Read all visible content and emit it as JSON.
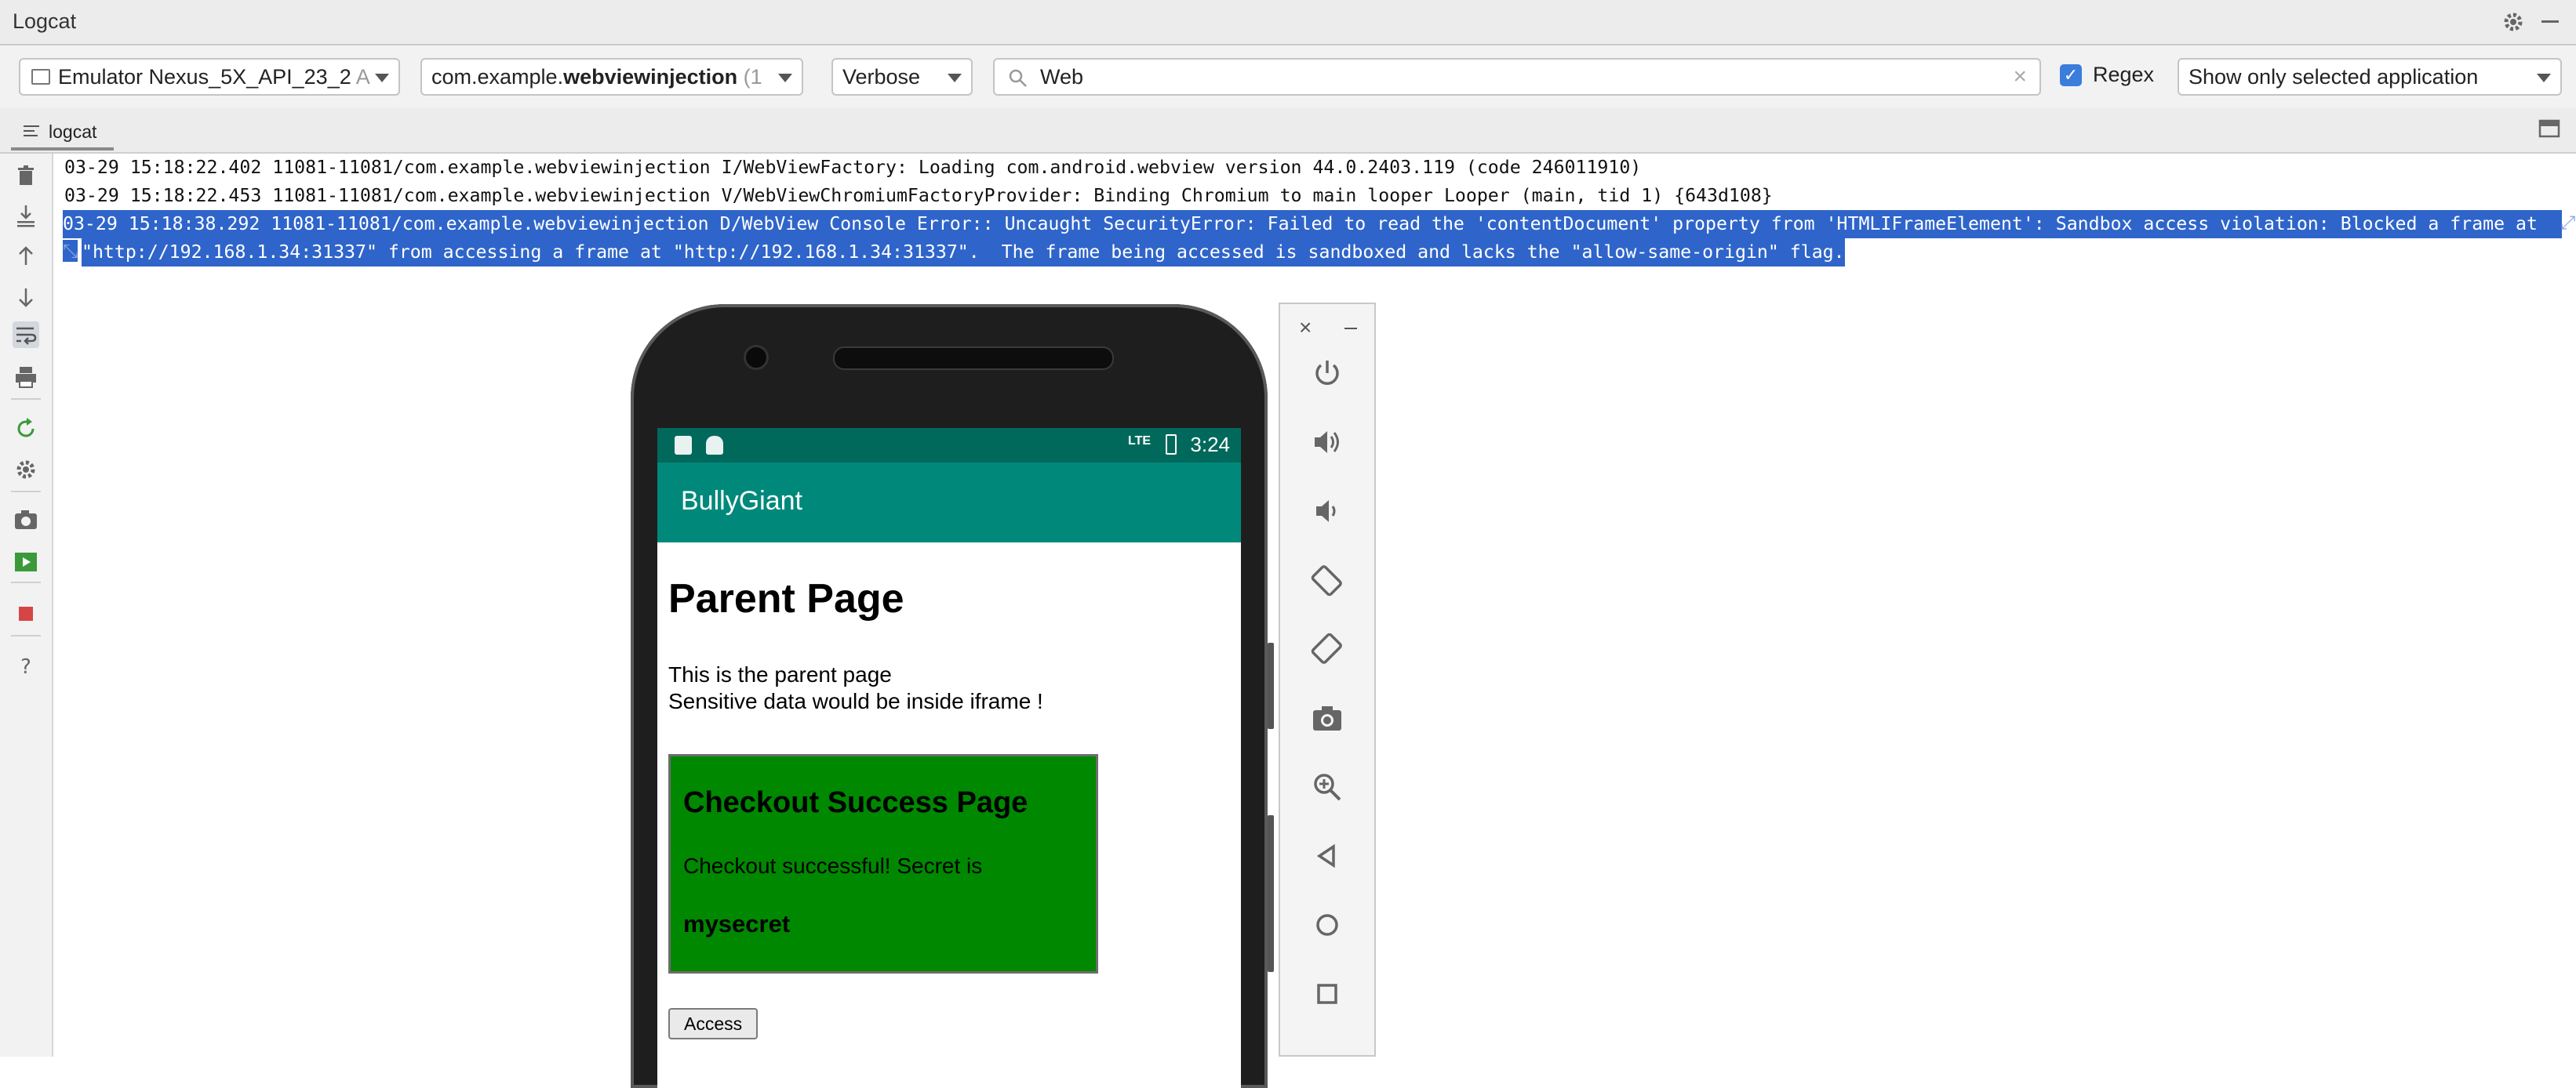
{
  "window": {
    "title": "Logcat"
  },
  "toolbar": {
    "device": "Emulator Nexus_5X_API_23_2",
    "device_suffix": "A",
    "process_prefix": "com.example.",
    "process_bold": "webviewinjection",
    "process_suffix": "(1",
    "level": "Verbose",
    "search_value": "Web",
    "regex_label": "Regex",
    "regex_checked": true,
    "filter": "Show only selected application"
  },
  "tabs": [
    {
      "label": "logcat"
    }
  ],
  "log": {
    "lines": [
      "03-29 15:18:22.402 11081-11081/com.example.webviewinjection I/WebViewFactory: Loading com.android.webview version 44.0.2403.119 (code 246011910)",
      "03-29 15:18:22.453 11081-11081/com.example.webviewinjection V/WebViewChromiumFactoryProvider: Binding Chromium to main looper Looper (main, tid 1) {643d108}",
      "03-29 15:18:38.292 11081-11081/com.example.webviewinjection D/WebView Console Error:: Uncaught SecurityError: Failed to read the 'contentDocument' property from 'HTMLIFrameElement': Sandbox access violation: Blocked a frame at",
      "\"http://192.168.1.34:31337\" from accessing a frame at \"http://192.168.1.34:31337\".  The frame being accessed is sandboxed and lacks the \"allow-same-origin\" flag."
    ]
  },
  "phone": {
    "status_time": "3:24",
    "status_net": "LTE",
    "app_title": "BullyGiant",
    "page_heading": "Parent Page",
    "page_text_1": "This is the parent page",
    "page_text_2": "Sensitive data would be inside iframe !",
    "iframe_heading": "Checkout Success Page",
    "iframe_text": "Checkout successful! Secret is",
    "iframe_secret": "mysecret",
    "access_button": "Access"
  },
  "colors": {
    "selection": "#2f65ca",
    "status_bar": "#00695c",
    "app_bar": "#00897b",
    "iframe_bg": "#008800"
  },
  "icons": {
    "left_toolbar": [
      "trash-icon",
      "scroll-to-end-icon",
      "up-arrow-icon",
      "down-arrow-icon",
      "soft-wrap-icon",
      "print-icon",
      "restart-icon",
      "settings-icon",
      "screenshot-icon",
      "screen-record-icon",
      "stop-icon",
      "help-icon"
    ],
    "emulator_panel": [
      "power-icon",
      "volume-up-icon",
      "volume-down-icon",
      "rotate-left-icon",
      "rotate-right-icon",
      "camera-icon",
      "zoom-icon",
      "back-icon",
      "home-icon",
      "overview-icon"
    ]
  }
}
